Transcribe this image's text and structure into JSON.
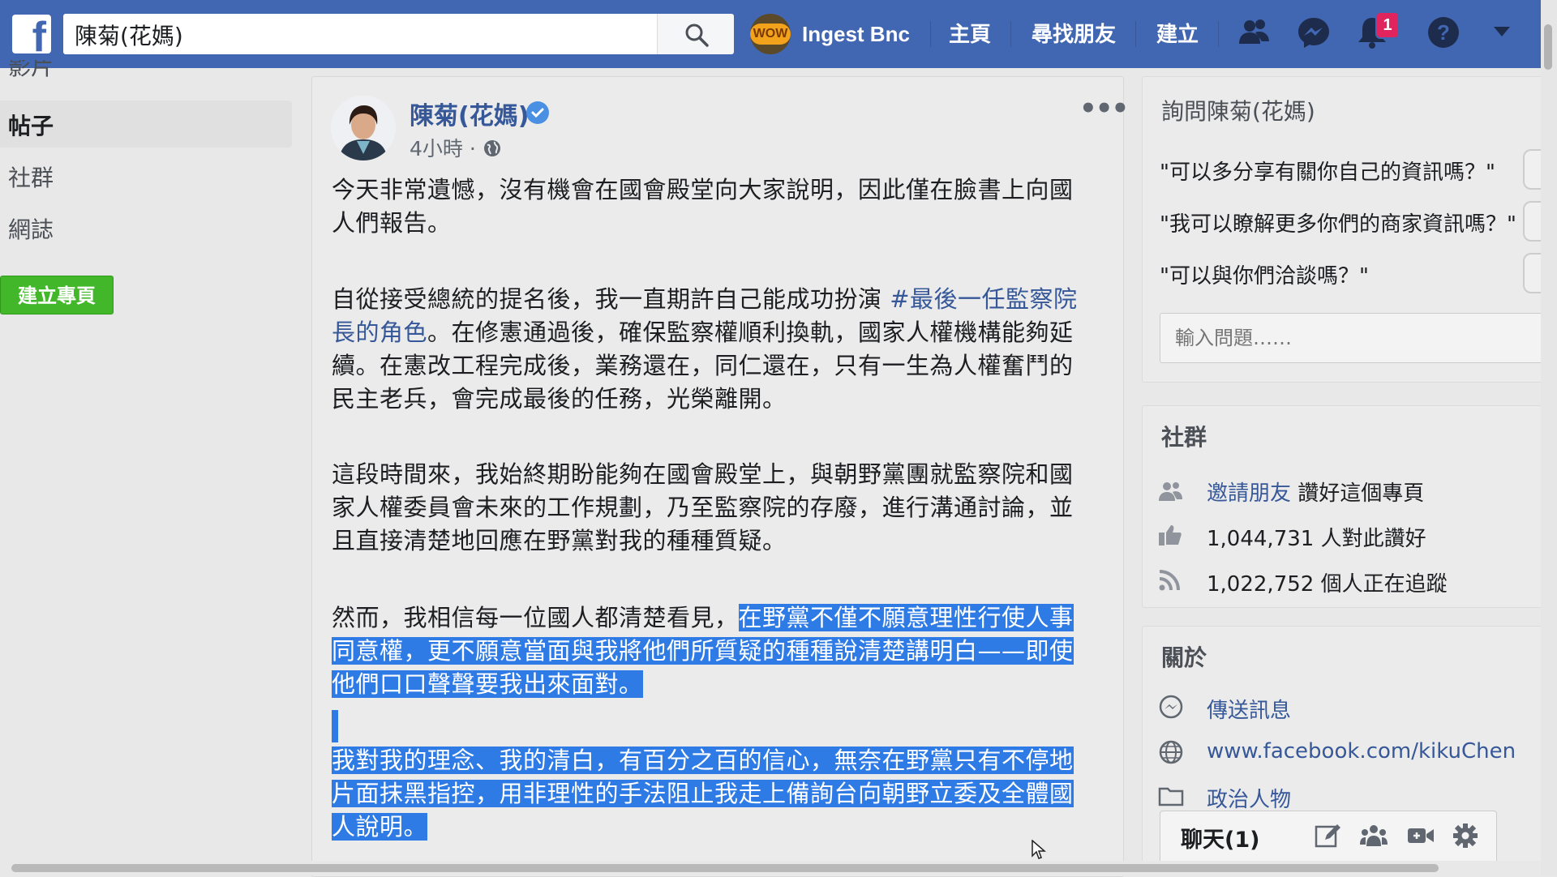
{
  "topbar": {
    "logo": "f",
    "search_value": "陳菊(花媽)",
    "search_placeholder": "搜尋",
    "profile_name": "Ingest Bnc",
    "avatar_badge": "WOW",
    "nav": [
      "主頁",
      "尋找朋友",
      "建立"
    ],
    "notification_count": "1",
    "icons": [
      "friends-icon",
      "messenger-icon",
      "notifications-icon",
      "help-icon",
      "account-menu-icon"
    ],
    "accent": "#4267b2"
  },
  "sidebar": {
    "partial_item": "影片",
    "items": [
      "帖子",
      "社群",
      "網誌"
    ],
    "active": "帖子",
    "create_page": "建立專頁"
  },
  "post": {
    "author": "陳菊(花媽)",
    "time": "4小時",
    "meta_sep": "·",
    "p1": "今天非常遺憾，沒有機會在國會殿堂向大家說明，因此僅在臉書上向國人們報告。",
    "p2_before": "自從接受總統的提名後，我一直期許自己能成功扮演 ",
    "p2_hashtag": "#最後一任監察院長的角色",
    "p2_after": "。在修憲通過後，確保監察權順利換軌，國家人權機構能夠延續。在憲改工程完成後，業務還在，同仁還在，只有一生為人權奮鬥的民主老兵，會完成最後的任務，光榮離開。",
    "p3": "這段時間來，我始終期盼能夠在國會殿堂上，與朝野黨團就監察院和國家人權委員會未來的工作規劃，乃至監察院的存廢，進行溝通討論，並且直接清楚地回應在野黨對我的種種質疑。",
    "p4_plain": "然而，我相信每一位國人都清楚看見，",
    "p4_highlight": "在野黨不僅不願意理性行使人事同意權，更不願意當面與我將他們所質疑的種種說清楚講明白——即使他們口口聲聲要我出來面對。",
    "p5_highlight": "我對我的理念、我的清白，有百分之百的信心，無奈在野黨只有不停地片面抹黑指控，用非理性的手法阻止我走上備詢台向朝野立委及全體國人說明。",
    "highlight_color": "#2e7be6"
  },
  "ask": {
    "title": "詢問陳菊(花媽)",
    "questions": [
      "\"可以多分享有關你自己的資訊嗎？\"",
      "\"我可以瞭解更多你們的商家資訊嗎？\"",
      "\"可以與你們洽談嗎？\""
    ],
    "input_placeholder": "輸入問題……"
  },
  "community": {
    "title": "社群",
    "invite_link": "邀請朋友",
    "invite_text": "讚好這個專頁",
    "likes": "1,044,731 人對此讚好",
    "followers": "1,022,752 個人正在追蹤"
  },
  "about": {
    "title": "關於",
    "message": "傳送訊息",
    "website": "www.facebook.com/kikuChen",
    "category": "政治人物"
  },
  "chat": {
    "title": "聊天(1)",
    "icons": [
      "compose-icon",
      "new-group-icon",
      "video-call-icon",
      "settings-icon"
    ]
  }
}
